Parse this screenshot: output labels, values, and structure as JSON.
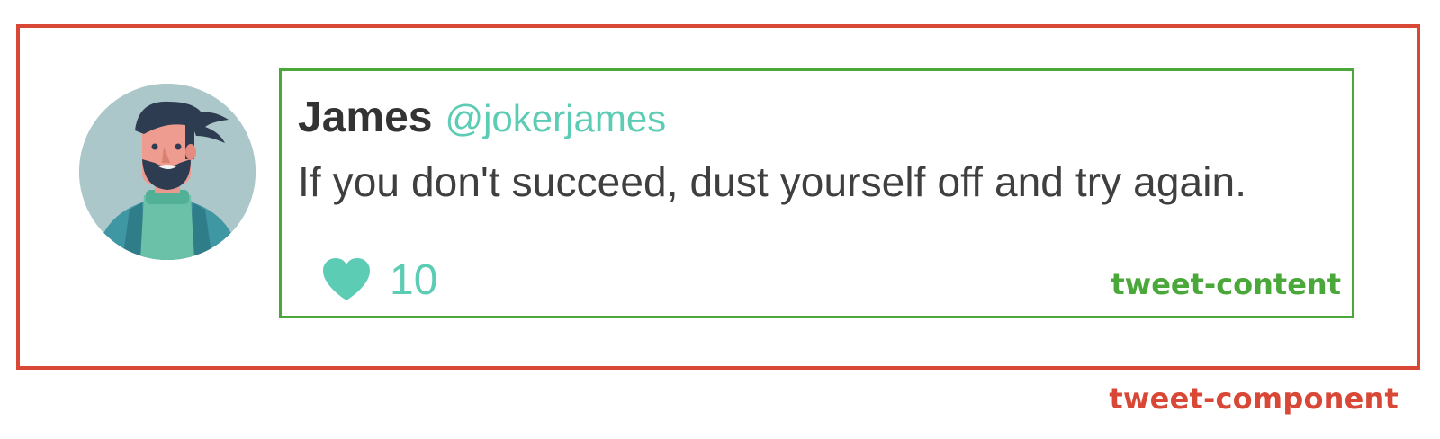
{
  "tweet": {
    "author_name": "James",
    "author_handle": "@jokerjames",
    "text": "If you don't succeed, dust yourself off and try again.",
    "likes": "10"
  },
  "annotations": {
    "outer_label": "tweet-component",
    "inner_label": "tweet-content"
  },
  "icons": {
    "like": "heart-icon",
    "avatar": "avatar-illustration"
  },
  "colors": {
    "outer_box": "#d94836",
    "inner_box": "#4aa83a",
    "accent": "#5cccb4",
    "name_text": "#333333",
    "body_text": "#3f3f3f",
    "avatar_bg": "#abc7c9"
  }
}
